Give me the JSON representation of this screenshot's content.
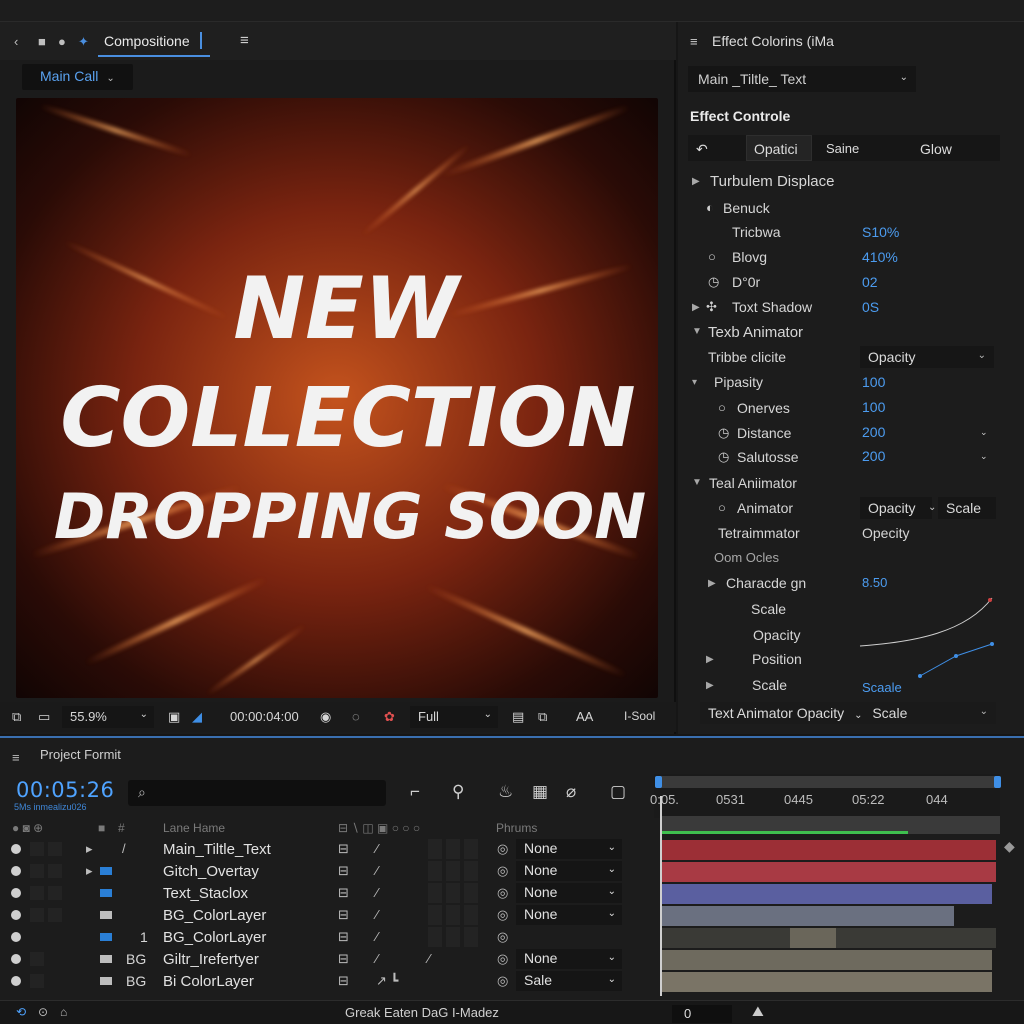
{
  "comp_panel": {
    "tab_label": "Compositione",
    "view_dropdown": "Main Call",
    "preview_lines": [
      "NEW",
      "COLLECTION",
      "DROPPING SOON"
    ],
    "toolbar": {
      "zoom": "55.9%",
      "timecode": "00:00:04:00",
      "resolution": "Full",
      "aa_label": "AA",
      "right_label": "I-Sool"
    }
  },
  "fx_panel": {
    "header": "Effect Colorins (iMa",
    "layer_select": "Main _Tiltle_ Text",
    "title": "Effect Controle",
    "tabs": [
      "Opatici",
      "Saine",
      "Glow"
    ],
    "rows": {
      "turbulent": "Turbulem Displace",
      "benuck": "Benuck",
      "tricbwa": "Tricbwa",
      "tricbwa_val": "S10%",
      "blovg": "Blovg",
      "blovg_val": "410%",
      "d0r": "D°0r",
      "d0r_val": "02",
      "text_shadow": "Toxt Shadow",
      "text_shadow_val": "0S",
      "text_animator": "Texb Animator",
      "tribe_clicite": "Tribbe clicite",
      "tribe_clicite_sel": "Opacity",
      "pipasity": "Pipasity",
      "pipasity_val": "100",
      "onerves": "Onerves",
      "onerves_val": "100",
      "distance": "Distance",
      "distance_val": "200",
      "salutose": "Salutosse",
      "salutose_val": "200",
      "teal_animator": "Teal Aniimator",
      "animator": "Animator",
      "animator_sel_a": "Opacity",
      "animator_sel_b": "Scale",
      "tetraimmator": "Tetraimmator",
      "tetraimmator_val": "Opecity",
      "oom_ocles": "Oom Ocles",
      "characde": "Characde gn",
      "characde_val": "8.50",
      "scale": "Scale",
      "opacity": "Opacity",
      "position": "Position",
      "scale2": "Scale",
      "scale2_val": "Scaale"
    },
    "bottom_select": "Text Animator Opacity",
    "bottom_select_b": "Scale"
  },
  "timeline": {
    "title": "Project Formit",
    "timecode": "00:05:26",
    "timecode_sub": "5Ms inmealizu026",
    "ruler_labels": [
      "0:05.",
      "0531",
      "0445",
      "05:22",
      "044"
    ],
    "columns": {
      "layer_name": "Lane Hame",
      "parent": "Phrums"
    },
    "layers": [
      {
        "num": "",
        "name": "Main_Tiltle_Text",
        "parent": "None"
      },
      {
        "num": "",
        "name": "Gitch_Overtay",
        "parent": "None"
      },
      {
        "num": "",
        "name": "Text_Staclox",
        "parent": "None"
      },
      {
        "num": "",
        "name": "BG_ColorLayer",
        "parent": "None"
      },
      {
        "num": "1",
        "name": "BG_ColorLayer",
        "parent": ""
      },
      {
        "num": "BG",
        "name": "Giltr_Irefertyer",
        "parent": "None"
      },
      {
        "num": "BG",
        "name": "Bi ColorLayer",
        "parent": "Sale"
      }
    ],
    "bottom_text": "Greak Eaten DaG I-Madez",
    "zoom_value": "0",
    "colors": {
      "accent": "#3f8fe6",
      "track_red": "#a8333a",
      "track_blue": "#5560a0",
      "track_gray": "#6a7080",
      "track_tan": "#7a7466"
    }
  }
}
